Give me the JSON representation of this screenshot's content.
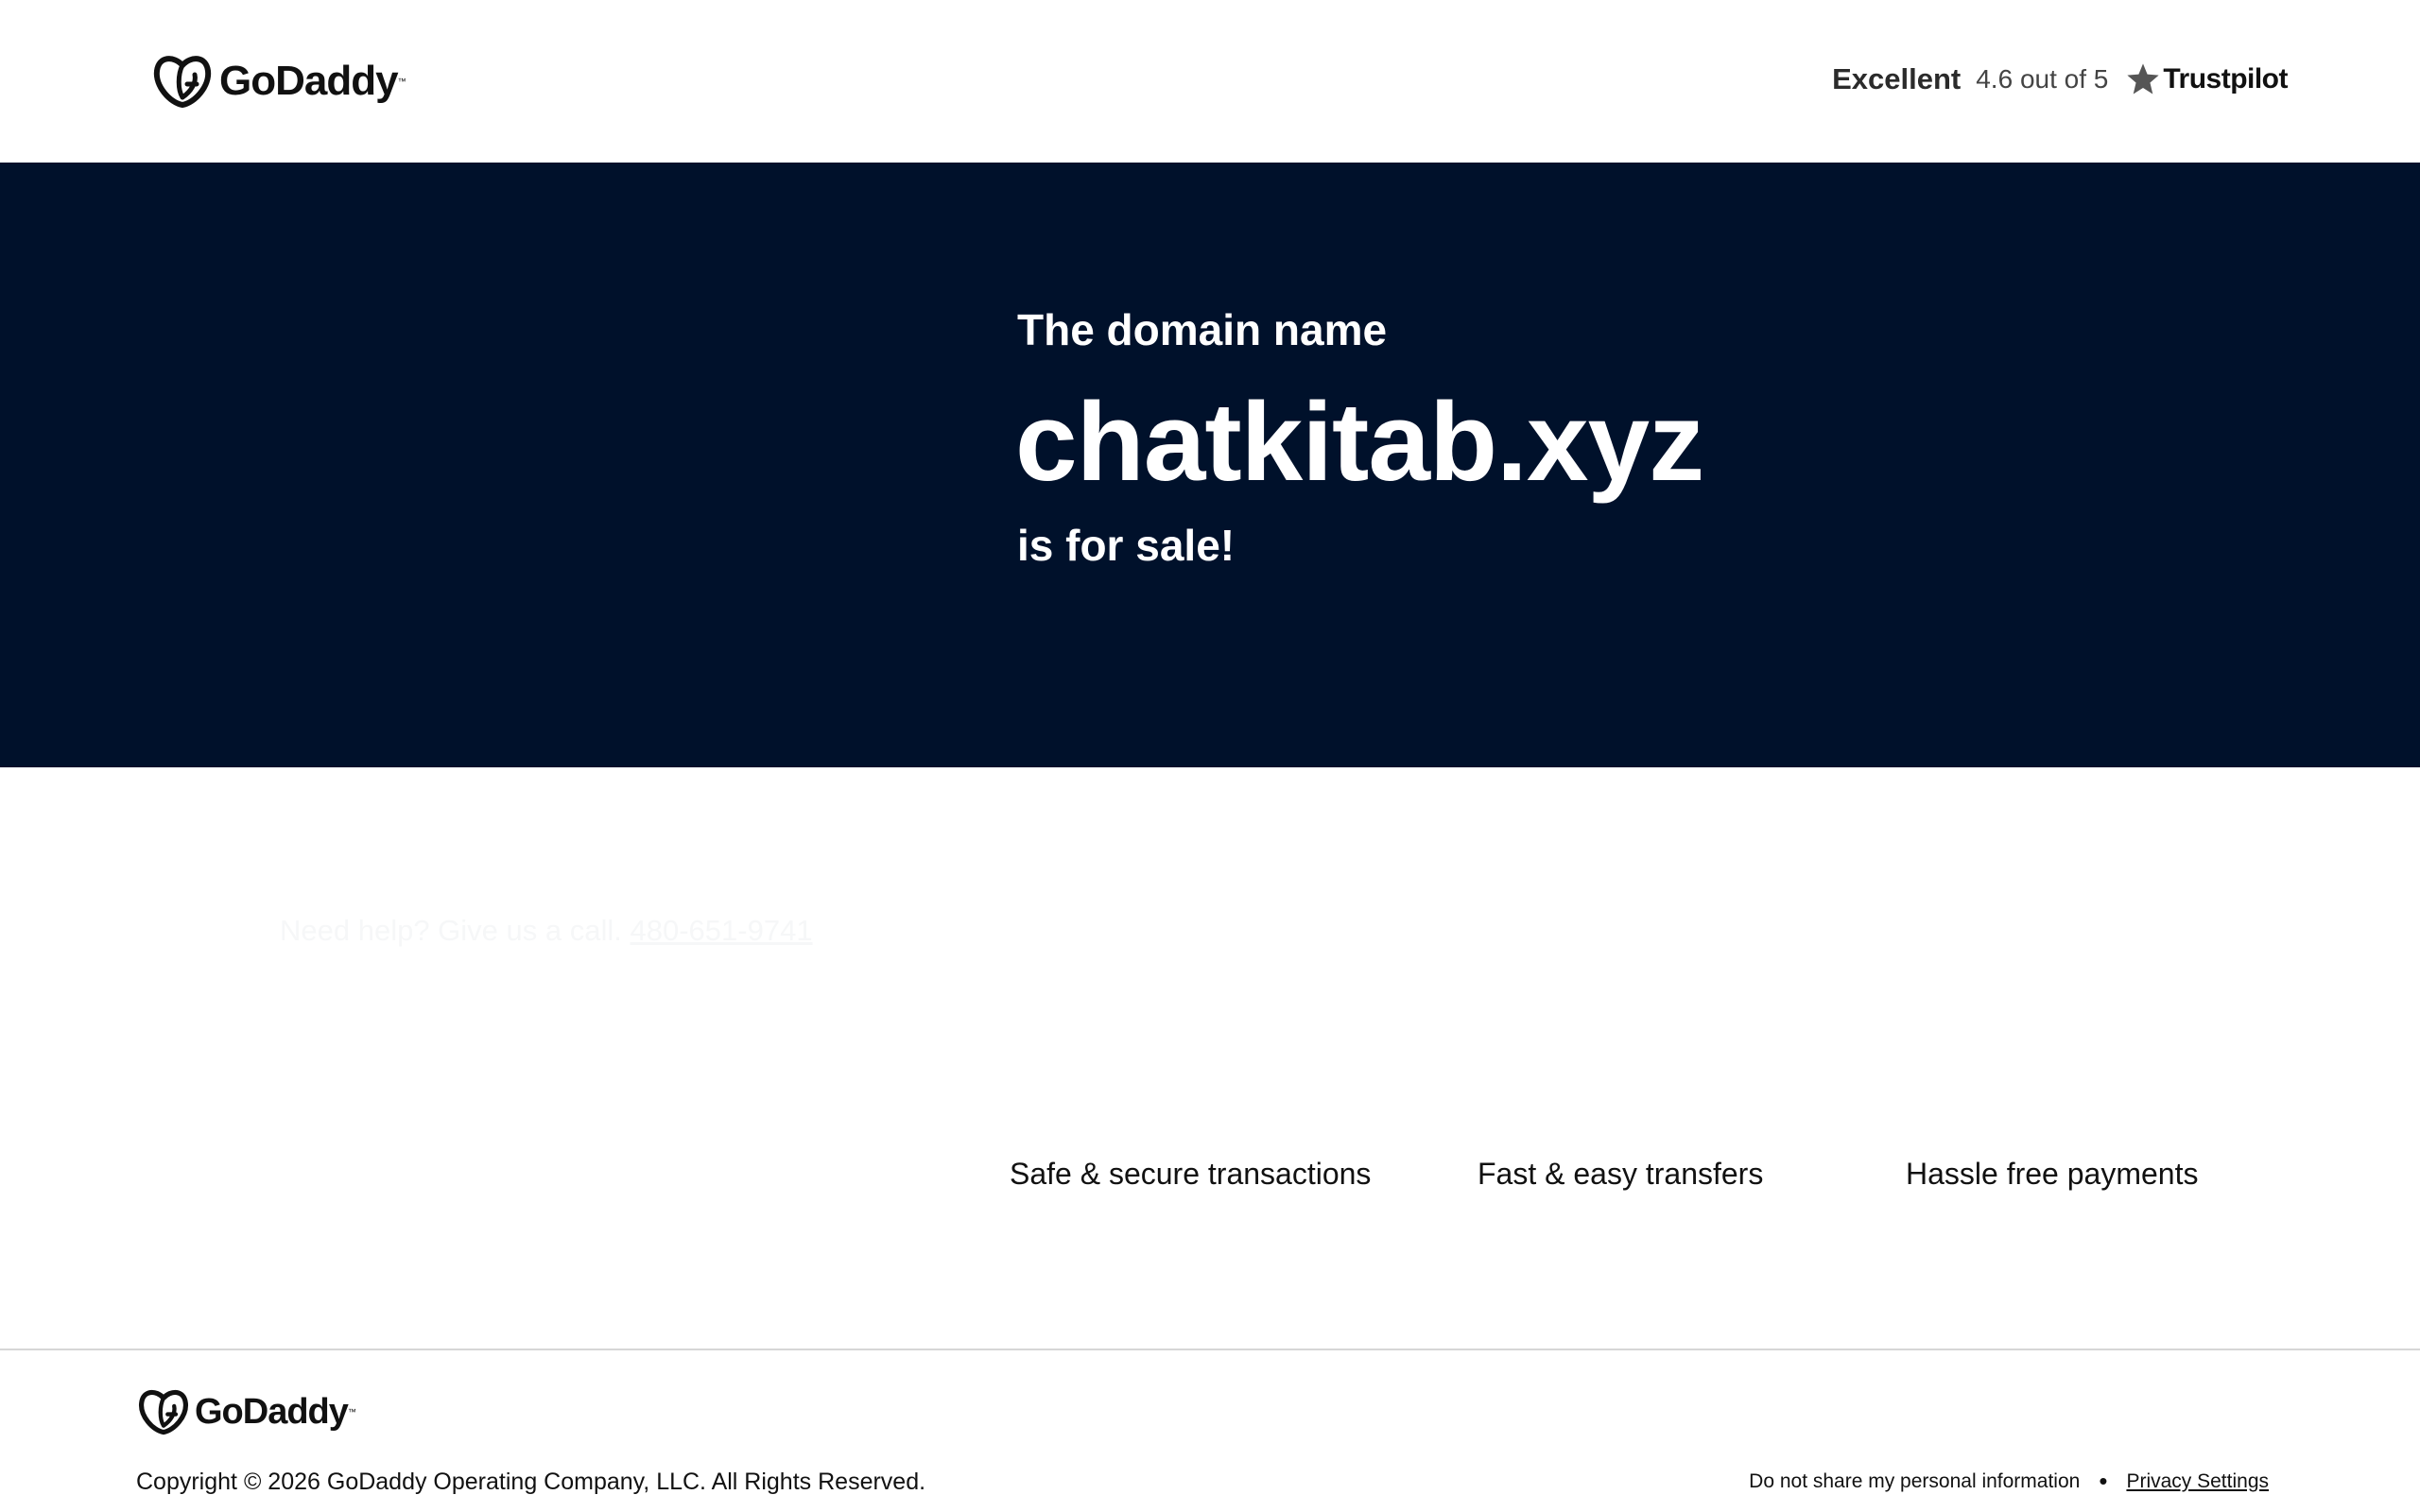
{
  "header": {
    "brand": "GoDaddy",
    "rating_word": "Excellent",
    "rating_score": "4.6 out of 5",
    "review_site": "Trustpilot"
  },
  "hero": {
    "subtitle": "The domain name",
    "domain": "chatkitab.xyz",
    "sale_text": "is for sale!"
  },
  "help": {
    "prompt": "Need help? Give us a call.",
    "phone": "480-651-9741"
  },
  "features": [
    "Safe & secure transactions",
    "Fast & easy transfers",
    "Hassle free payments"
  ],
  "footer": {
    "brand": "GoDaddy",
    "copyright": "Copyright © 2026 GoDaddy Operating Company, LLC. All Rights Reserved.",
    "do_not_share": "Do not share my personal information",
    "privacy_settings": "Privacy Settings"
  },
  "colors": {
    "hero_bg": "#00112b",
    "text": "#111111",
    "trustpilot_star": "#555555"
  },
  "icons": {
    "brand_logo": "godaddy-logo-icon",
    "rating_star": "star-icon"
  }
}
